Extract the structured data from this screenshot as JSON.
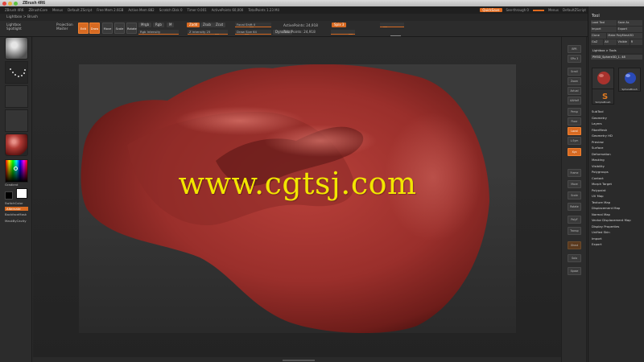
{
  "window": {
    "title": "ZBrush 4R6"
  },
  "menubar": {
    "items": [
      "ZBrush 4R6",
      "ZBrushCore",
      "Menus",
      "Default ZScript",
      "Free Mem 2.6GB",
      "Active Mem 882",
      "Scratch Disk 0",
      "Timer 0.001",
      "ActivePoints 60,000",
      "TotalPoints 1.23 Mil"
    ],
    "right_items": [
      "QuickSave",
      "See-through 0",
      "Menus",
      "DefaultZScript"
    ]
  },
  "subheader": {
    "text": "Lightbox > Brush"
  },
  "shelf": {
    "tool_left": "Lightbox Spotlight",
    "projection": "Projection Master",
    "buttons": [
      "Edit",
      "Draw",
      "Move",
      "Scale",
      "Rotate"
    ],
    "mrgb": "Mrgb",
    "rgb": "Rgb",
    "m": "M",
    "rgb_intensity_label": "Rgb Intensity",
    "zadd": "Zadd",
    "zsub": "Zsub",
    "zcut": "Zcut",
    "focal_shift": "Focal Shift 0",
    "draw_size": "Draw Size 64",
    "z_intensity": "Z Intensity 25",
    "dynamic": "Dynamic",
    "active_points": "ActivePoints: 24,918",
    "total_points": "TotalPoints: 24,918",
    "spix": "Spix 3"
  },
  "left_tray": {
    "gradient_label": "Gradient",
    "switch_color": "SwitchColor",
    "alternate": "Alternate",
    "backface_mask": "BackfaceMask",
    "mask_by_cavity": "MaskByCavity"
  },
  "watermark": "www.cgtsj.com",
  "right_shelf": {
    "buttons": [
      "BPR",
      "SPix 3",
      "Scroll",
      "Zoom",
      "Actual",
      "AAHalf",
      "Persp",
      "Floor",
      "Local",
      "L.Sym",
      "Xyz",
      "Frame",
      "Move",
      "Scale",
      "Rotate",
      "PolyF",
      "Transp",
      "Ghost",
      "Solo",
      "Xpose"
    ]
  },
  "tool_palette": {
    "title": "Tool",
    "rows": [
      [
        "Load Tool",
        "Save As"
      ],
      [
        "Import",
        "Export"
      ],
      [
        "Clone",
        "Make PolyMesh3D"
      ],
      [
        "GoZ",
        "All",
        "Visible",
        "R"
      ]
    ],
    "lightbox_tools": "Lightbox > Tools",
    "current_tool": "PM3D_Sphere3D_1. 48",
    "thumb1_caption": "PM3D_Sphere3D",
    "thumb2_caption": "SimpleBrush",
    "thumb3_caption": "SphereBrush",
    "menu": [
      "SubTool",
      "Geometry",
      "Layers",
      "FiberMesh",
      "Geometry HD",
      "Preview",
      "Surface",
      "Deformation",
      "Masking",
      "Visibility",
      "Polygroups",
      "Contact",
      "Morph Target",
      "Polypaint",
      "UV Map",
      "Texture Map",
      "Displacement Map",
      "Normal Map",
      "Vector Displacement Map",
      "Display Properties",
      "Unified Skin",
      "Import",
      "Export"
    ]
  },
  "colors": {
    "accent": "#d76a22",
    "watermark": "#f2e600",
    "model": "#9a2f2b"
  }
}
